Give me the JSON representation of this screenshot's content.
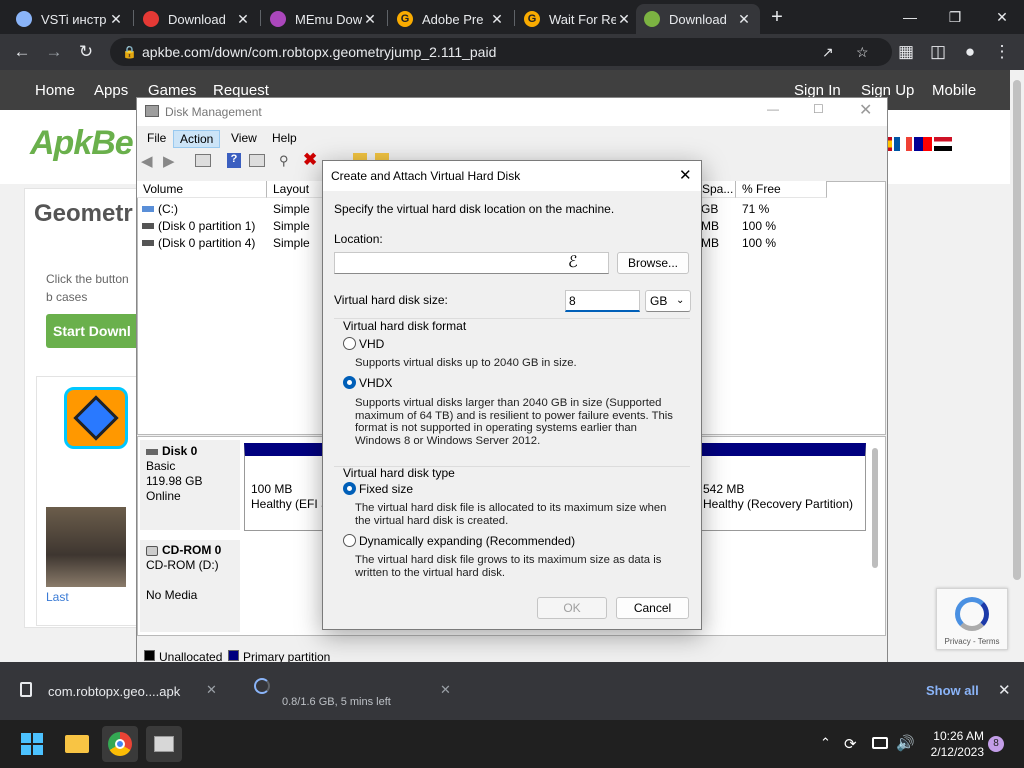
{
  "browser": {
    "tabs": [
      {
        "title": "VSTi инстр",
        "favicon": "globe-icon",
        "fav_color": "#8ab4f8",
        "fav_glyph": ""
      },
      {
        "title": "Download",
        "favicon": "brush-icon",
        "fav_color": "#e53935",
        "fav_glyph": ""
      },
      {
        "title": "MEmu Dow",
        "favicon": "memu-icon",
        "fav_color": "#ab47bc",
        "fav_glyph": ""
      },
      {
        "title": "Adobe Pre",
        "favicon": "g-icon",
        "fav_color": "#f9ab00",
        "fav_glyph": "G"
      },
      {
        "title": "Wait For Re",
        "favicon": "g-icon",
        "fav_color": "#f9ab00",
        "fav_glyph": "G"
      },
      {
        "title": "Download",
        "favicon": "android-icon",
        "fav_color": "#7cb342",
        "fav_glyph": ""
      }
    ],
    "active_tab": 5,
    "url": "apkbe.com/down/com.robtopx.geometryjump_2.111_paid"
  },
  "site": {
    "nav_left": [
      "Home",
      "Apps",
      "Games",
      "Request"
    ],
    "nav_right": [
      "Sign In",
      "Sign Up",
      "Mobile"
    ],
    "logo": "ApkBe",
    "page_title": "Geometr",
    "click_text": "Click the button b cases",
    "start_button": "Start Downl",
    "last_link": "Last",
    "recaptcha_links": "Privacy - Terms",
    "brand_color": "#6ab04c"
  },
  "disk_management": {
    "title": "Disk Management",
    "menu": [
      "File",
      "Action",
      "View",
      "Help"
    ],
    "selected_menu": "Action",
    "columns": [
      "Volume",
      "Layout",
      "Spa...",
      "% Free"
    ],
    "volumes": [
      {
        "name": "(C:)",
        "layout": "Simple",
        "space": "GB",
        "free": "71 %"
      },
      {
        "name": "(Disk 0 partition 1)",
        "layout": "Simple",
        "space": "MB",
        "free": "100 %"
      },
      {
        "name": "(Disk 0 partition 4)",
        "layout": "Simple",
        "space": "MB",
        "free": "100 %"
      }
    ],
    "disk0": {
      "name": "Disk 0",
      "type": "Basic",
      "size": "119.98 GB",
      "status": "Online"
    },
    "partitions": [
      {
        "size": "100 MB",
        "status": "Healthy (EFI S"
      },
      {
        "size": "542 MB",
        "status": "Healthy (Recovery Partition)"
      }
    ],
    "cdrom": {
      "name": "CD-ROM 0",
      "drive": "CD-ROM (D:)",
      "media": "No Media"
    },
    "legend": [
      "Unallocated",
      "Primary partition"
    ],
    "primary_color": "#00007f"
  },
  "dialog": {
    "title": "Create and Attach Virtual Hard Disk",
    "instruction": "Specify the virtual hard disk location on the machine.",
    "location_label": "Location:",
    "location_value": "",
    "browse_label": "Browse...",
    "size_label": "Virtual hard disk size:",
    "size_value": "8",
    "size_unit": "GB",
    "format_group": "Virtual hard disk format",
    "vhd_label": "VHD",
    "vhd_desc": "Supports virtual disks up to 2040 GB in size.",
    "vhdx_label": "VHDX",
    "vhdx_desc": "Supports virtual disks larger than 2040 GB in size (Supported maximum of 64 TB) and is resilient to power failure events. This format is not supported in operating systems earlier than Windows 8 or Windows Server 2012.",
    "type_group": "Virtual hard disk type",
    "fixed_label": "Fixed size",
    "fixed_desc": "The virtual hard disk file is allocated to its maximum size when the virtual hard disk is created.",
    "dynamic_label": "Dynamically expanding (Recommended)",
    "dynamic_desc": "The virtual hard disk file grows to its maximum size as data is written to the virtual hard disk.",
    "ok_label": "OK",
    "cancel_label": "Cancel",
    "accent_color": "#005fb8"
  },
  "downloads": {
    "item1": "com.robtopx.geo....apk",
    "item2": "0.8/1.6 GB, 5 mins left",
    "show_all": "Show all"
  },
  "taskbar": {
    "time": "10:26 AM",
    "date": "2/12/2023",
    "notifications": "8"
  }
}
